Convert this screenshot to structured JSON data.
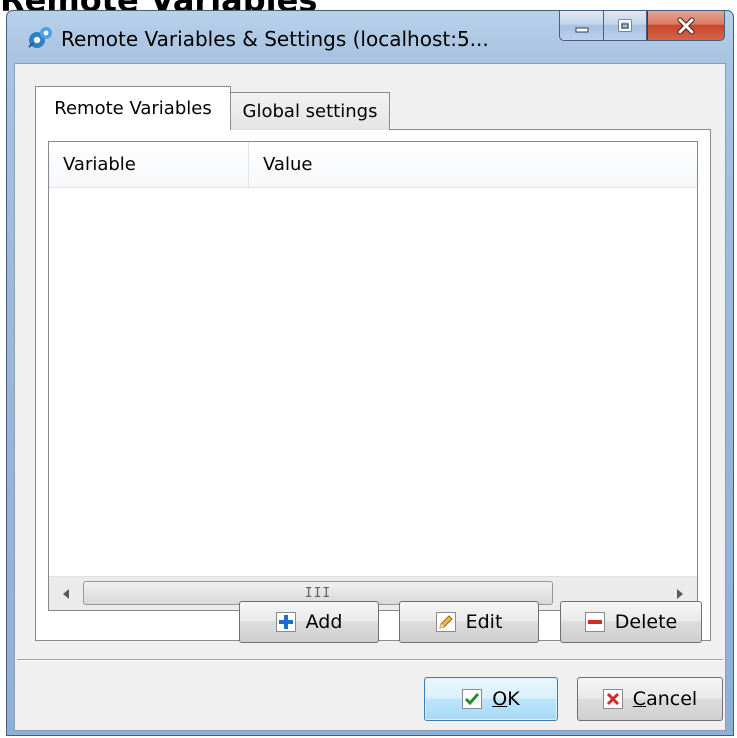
{
  "page": {
    "heading": "Remote Variables"
  },
  "window": {
    "title": "Remote Variables & Settings (localhost:5...",
    "icon": "app-gears-icon"
  },
  "tabs": [
    {
      "label": "Remote Variables",
      "active": true
    },
    {
      "label": "Global settings",
      "active": false
    }
  ],
  "list": {
    "columns": [
      "Variable",
      "Value"
    ],
    "rows": [],
    "scrollbar": {
      "grip": "III"
    }
  },
  "actions": {
    "add_label": "Add",
    "edit_label": "Edit",
    "delete_label": "Delete"
  },
  "dialog": {
    "ok_mnemonic": "O",
    "ok_rest": "K",
    "cancel_mnemonic": "C",
    "cancel_rest": "ancel"
  },
  "colors": {
    "add_icon": "#1a6fc9",
    "edit_icon": "#e6a23a",
    "delete_icon": "#d42a2a",
    "ok_check": "#2a8a25",
    "cancel_x": "#d42a2a"
  }
}
